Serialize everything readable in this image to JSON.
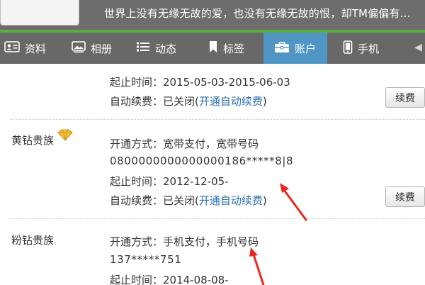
{
  "banner": {
    "signature": "世界上没有无缘无故的爱，也没有无缘无故的恨，却TM偏偏有..."
  },
  "tabs": [
    {
      "label": "资料",
      "icon": "profile-card-icon"
    },
    {
      "label": "相册",
      "icon": "photo-album-icon"
    },
    {
      "label": "动态",
      "icon": "list-icon"
    },
    {
      "label": "标签",
      "icon": "bookmark-icon"
    },
    {
      "label": "账户",
      "icon": "briefcase-icon",
      "active": true
    },
    {
      "label": "手机",
      "icon": "mobile-phone-icon"
    }
  ],
  "content": {
    "block1": {
      "period": "起止时间：2015-05-03-2015-06-03",
      "autorenew_prefix": "自动续费：已关闭(",
      "autorenew_link": "开通自动续费",
      "autorenew_suffix": ")",
      "renew_label": "续费"
    },
    "block2": {
      "tier": "黄钻贵族",
      "method": "开通方式：宽带支付，宽带号码",
      "account": "0800000000000000186*****8|8",
      "period": "起止时间：2012-12-05-",
      "autorenew_prefix": "自动续费：已关闭(",
      "autorenew_link": "开通自动续费",
      "autorenew_suffix": ")",
      "renew_label": "续费"
    },
    "block3": {
      "tier": "粉钻贵族",
      "tier_mark": "。",
      "method": "开通方式：手机支付，手机号码",
      "account": "137*****751",
      "period": "起止时间：2014-08-08-"
    }
  },
  "colors": {
    "active_tab": "#4f96c5",
    "tab_bar": "#686868",
    "accent_line": "#5cae3a",
    "link": "#2c6fb3",
    "arrow": "#e8281e"
  }
}
